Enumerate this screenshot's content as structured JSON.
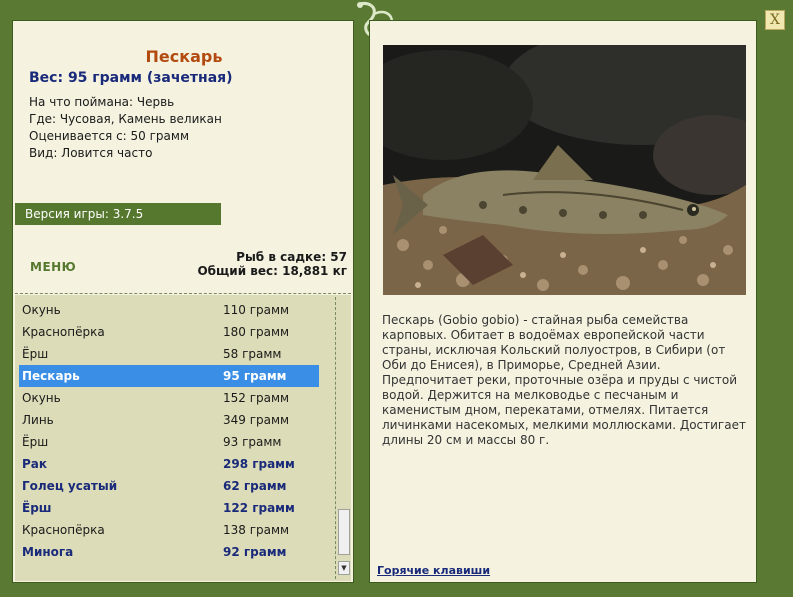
{
  "fish": {
    "title": "Пескарь",
    "weight_line": "Вес: 95 грамм (зачетная)",
    "caught_on": "На что поймана: Червь",
    "where": "Где: Чусовая, Камень великан",
    "rated_from": "Оценивается с: 50 грамм",
    "kind": "Вид: Ловится часто"
  },
  "version": "Версия игры: 3.7.5",
  "menu_label": "МЕНЮ",
  "stats": {
    "count": "Рыб в садке: 57",
    "total": "Общий вес: 18,881 кг"
  },
  "list": [
    {
      "name": "Окунь",
      "weight": "110 грамм",
      "style": "normal"
    },
    {
      "name": "Краснопёрка",
      "weight": "180 грамм",
      "style": "normal"
    },
    {
      "name": "Ёрш",
      "weight": "58 грамм",
      "style": "normal"
    },
    {
      "name": "Пескарь",
      "weight": "95 грамм",
      "style": "selected"
    },
    {
      "name": "Окунь",
      "weight": "152 грамм",
      "style": "normal"
    },
    {
      "name": "Линь",
      "weight": "349 грамм",
      "style": "normal"
    },
    {
      "name": "Ёрш",
      "weight": "93 грамм",
      "style": "normal"
    },
    {
      "name": "Рак",
      "weight": "298 грамм",
      "style": "bold"
    },
    {
      "name": "Голец усатый",
      "weight": "62 грамм",
      "style": "bold"
    },
    {
      "name": "Ёрш",
      "weight": "122 грамм",
      "style": "bold"
    },
    {
      "name": "Краснопёрка",
      "weight": "138 грамм",
      "style": "normal"
    },
    {
      "name": "Минога",
      "weight": "92 грамм",
      "style": "bold"
    }
  ],
  "description": "Пескарь (Gobio gobio) - стайная рыба семейства карповых. Обитает в водоёмах европейской части страны, исключая Кольский полуостров, в Сибири (от Оби до Енисея), в Приморье, Средней Азии. Предпочитает реки, проточные озёра и пруды с чистой водой. Держится на мелководье с песчаным и каменистым дном, перекатами, отмелях. Питается личинками насекомых, мелкими моллюсками. Достигает длины 20 см и массы 80 г.",
  "hotkeys_label": "Горячие клавиши",
  "close_label": "X",
  "colors": {
    "frame_green": "#5a7a33",
    "panel_bg": "#f5f3e0",
    "title_orange": "#b34a10",
    "navy": "#1a2a7a",
    "selected_blue": "#3a8ee6",
    "list_bg": "#dcdcb8"
  }
}
